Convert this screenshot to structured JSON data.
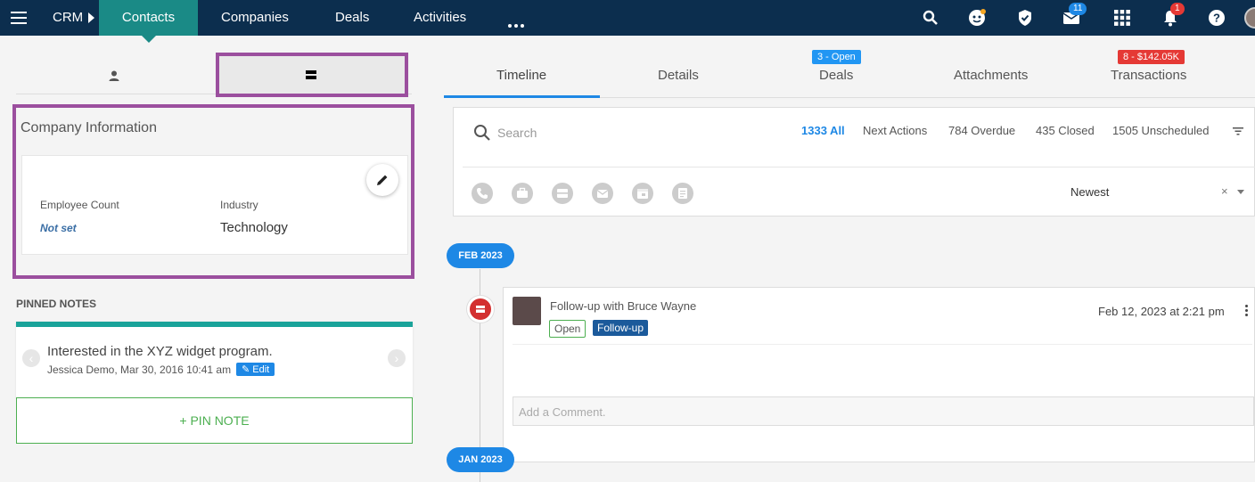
{
  "topbar": {
    "app": "CRM",
    "tabs": [
      "Contacts",
      "Companies",
      "Deals",
      "Activities"
    ],
    "mail_badge": "11",
    "bell_badge": "1"
  },
  "left": {
    "company_info_title": "Company Information",
    "employee_count_label": "Employee Count",
    "employee_count_value": "Not set",
    "industry_label": "Industry",
    "industry_value": "Technology",
    "pinned_notes_title": "PINNED NOTES",
    "note_text": "Interested in the XYZ widget program.",
    "note_meta": "Jessica Demo, Mar 30, 2016 10:41 am",
    "note_edit": "Edit",
    "pin_note": "+ PIN NOTE"
  },
  "right": {
    "tabs": [
      "Timeline",
      "Details",
      "Deals",
      "Attachments",
      "Transactions"
    ],
    "deals_badge": "3 - Open",
    "transactions_badge": "8 - $142.05K",
    "search_placeholder": "Search",
    "filters": [
      "1333 All",
      "Next Actions",
      "784 Overdue",
      "435 Closed",
      "1505 Unscheduled"
    ],
    "sort": "Newest",
    "sort_clear": "×",
    "date_groups": [
      "FEB 2023",
      "JAN 2023"
    ],
    "event": {
      "title": "Follow-up with Bruce Wayne",
      "status": "Open",
      "type": "Follow-up",
      "date": "Feb 12, 2023 at 2:21 pm",
      "comment_placeholder": "Add a Comment."
    }
  },
  "colors": {
    "nav_bg": "#0c2e4e",
    "nav_active": "#1a8a86",
    "accent": "#1e88e5",
    "highlight": "#9b4f9e"
  }
}
